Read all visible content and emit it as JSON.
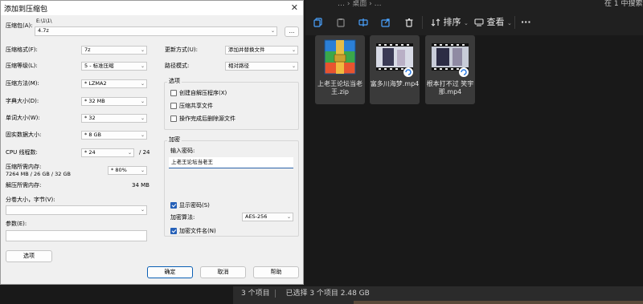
{
  "explorer": {
    "breadcrumb": "… › 桌面 › …",
    "search_label": "在 1 中搜索",
    "toolbar": {
      "sort_label": "排序",
      "view_label": "查看",
      "more_label": "···"
    },
    "files": [
      {
        "name": "上老王论坛当老王.zip",
        "kind": "archive"
      },
      {
        "name": "富多川海梦.mp4",
        "kind": "video"
      },
      {
        "name": "根本打不过 笑宇那.mp4",
        "kind": "video"
      }
    ],
    "status": {
      "count": "3 个项目",
      "selected": "已选择 3 个项目 2.48 GB"
    },
    "colors": {
      "bg": "#191919",
      "toolbar": "#202020",
      "selected_tile": "#3a3a3a"
    }
  },
  "dialog": {
    "title": "添加到压缩包",
    "close_label": "✕",
    "archive": {
      "label": "压缩包(A):",
      "path": "E:\\1\\1\\",
      "value": "4.7z",
      "browse_label": "..."
    },
    "left": {
      "format": {
        "label": "压缩格式(F):",
        "value": "7z"
      },
      "level": {
        "label": "压缩等级(L):",
        "value": "5 - 标准压缩"
      },
      "method": {
        "label": "压缩方法(M):",
        "value": "* LZMA2"
      },
      "dict": {
        "label": "字典大小(D):",
        "value": "* 32 MB"
      },
      "word": {
        "label": "单词大小(W):",
        "value": "* 32"
      },
      "solid": {
        "label": "固实数据大小:",
        "value": "* 8 GB"
      },
      "threads": {
        "label": "CPU 线程数:",
        "value": "* 24",
        "total": "/ 24"
      },
      "mem_compress": {
        "label": "压缩所需内存:",
        "detail": "7264 MB / 26 GB / 32 GB",
        "value": "* 80%"
      },
      "mem_decompress": {
        "label": "解压所需内存:",
        "value": "34 MB"
      },
      "split": {
        "label": "分卷大小，字节(V):",
        "value": ""
      },
      "params": {
        "label": "参数(E):",
        "value": ""
      },
      "options_button": "选项"
    },
    "right": {
      "update_mode": {
        "label": "更新方式(U):",
        "value": "添加并替换文件"
      },
      "path_mode": {
        "label": "路径模式:",
        "value": "相对路径"
      },
      "options_group": "选项",
      "opt_sfx": {
        "label": "创建自解压程序(X)",
        "checked": false
      },
      "opt_shared": {
        "label": "压缩共享文件",
        "checked": false
      },
      "opt_delete": {
        "label": "操作完成后删除源文件",
        "checked": false
      },
      "encrypt_group": "加密",
      "password_label": "输入密码:",
      "password_value": "上老王论坛当老王",
      "show_password": {
        "label": "显示密码(S)",
        "checked": true
      },
      "enc_method": {
        "label": "加密算法:",
        "value": "AES-256"
      },
      "enc_names": {
        "label": "加密文件名(N)",
        "checked": true
      }
    },
    "buttons": {
      "ok": "确定",
      "cancel": "取消",
      "help": "帮助"
    }
  }
}
